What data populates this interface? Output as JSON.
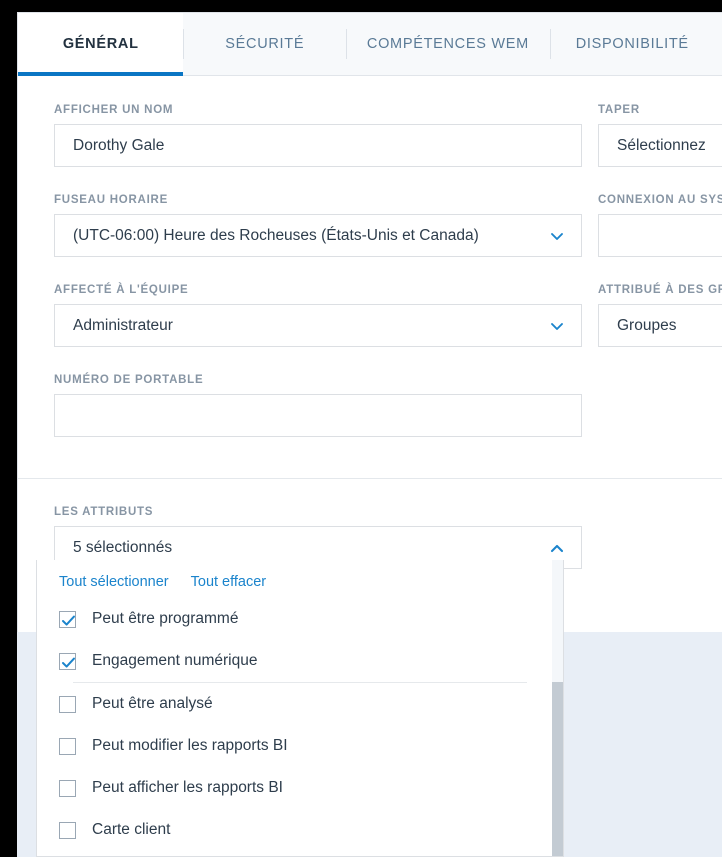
{
  "window": {
    "active_tab": "GÉNÉRAL"
  },
  "tabs": [
    {
      "label": "GÉNÉRAL",
      "active": true
    },
    {
      "label": "SÉCURITÉ",
      "active": false
    },
    {
      "label": "COMPÉTENCES WEM",
      "active": false
    },
    {
      "label": "DISPONIBILITÉ",
      "active": false
    }
  ],
  "form": {
    "left": [
      {
        "label": "AFFICHER UN NOM",
        "value": "Dorothy Gale",
        "type": "text",
        "name": "display-name"
      },
      {
        "label": "FUSEAU HORAIRE",
        "value": "(UTC-06:00) Heure des Rocheuses (États-Unis et Canada)",
        "type": "select",
        "name": "timezone"
      },
      {
        "label": "AFFECTÉ À L'ÉQUIPE",
        "value": "Administrateur",
        "type": "select",
        "name": "assigned-team"
      },
      {
        "label": "NUMÉRO DE PORTABLE",
        "value": "",
        "type": "text",
        "name": "mobile-number"
      }
    ],
    "right": [
      {
        "label": "TAPER",
        "value": "Sélectionnez",
        "type": "select",
        "name": "type"
      },
      {
        "label": "CONNEXION AU SYSTÈME",
        "value": "",
        "type": "text",
        "name": "system-login"
      },
      {
        "label": "ATTRIBUÉ À DES GROUPES",
        "value": "Groupes",
        "type": "select",
        "name": "assigned-groups"
      }
    ]
  },
  "attributes": {
    "label": "LES ATTRIBUTS",
    "summary": "5 sélectionnés",
    "select_all_label": "Tout sélectionner",
    "clear_all_label": "Tout effacer",
    "items": [
      {
        "label": "Peut être programmé",
        "checked": true
      },
      {
        "label": "Engagement numérique",
        "checked": true
      },
      {
        "label": "Peut être analysé",
        "checked": false
      },
      {
        "label": "Peut modifier les rapports BI",
        "checked": false
      },
      {
        "label": "Peut afficher les rapports BI",
        "checked": false
      },
      {
        "label": "Carte client",
        "checked": false
      }
    ]
  },
  "colors": {
    "accent": "#0a76c4",
    "link": "#1b84cc",
    "label": "#8795a4",
    "text": "#2e3d4c",
    "backdrop": "#e8eef6",
    "border": "#dcdfe3"
  }
}
